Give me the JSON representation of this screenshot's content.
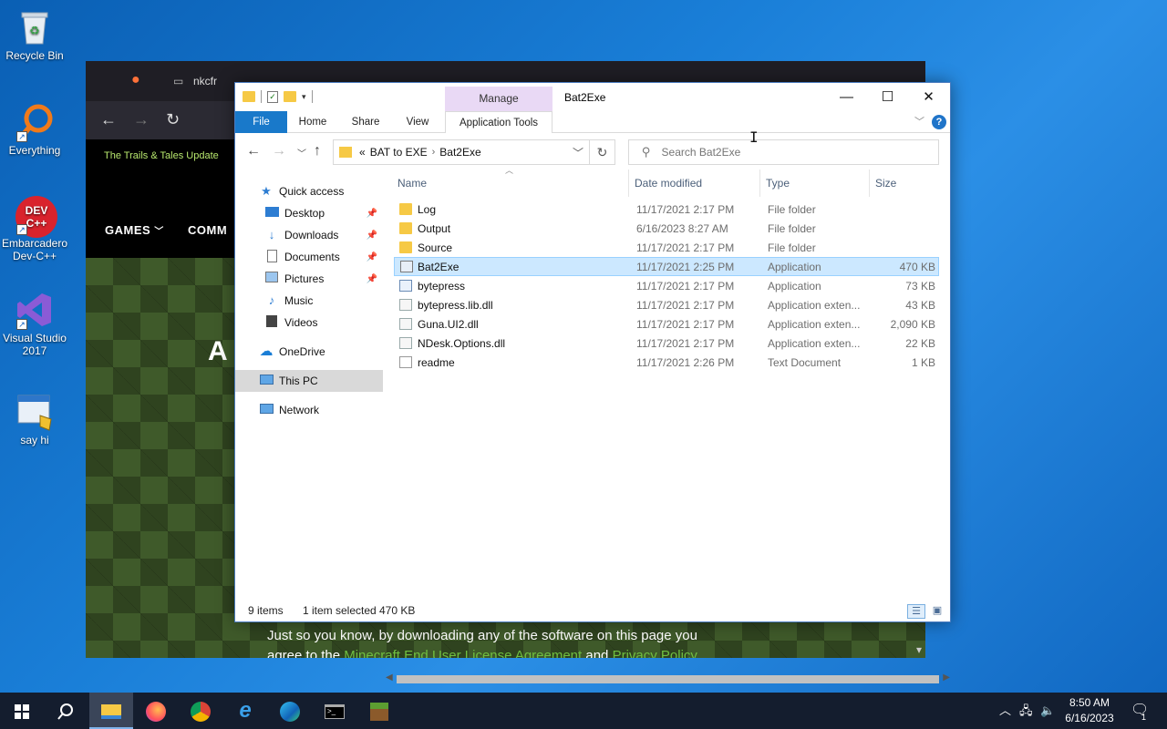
{
  "desktop": {
    "icons": [
      {
        "label": "Recycle Bin"
      },
      {
        "label": "Everything"
      },
      {
        "label": "Embarcadero Dev-C++"
      },
      {
        "label": "Visual Studio 2017"
      },
      {
        "label": "say hi"
      }
    ]
  },
  "browser": {
    "tab_label": "nkcfr",
    "promo_text": "The Trails & Tales Update",
    "menu_games": "GAMES",
    "menu_community": "COMM",
    "hero_letter": "A",
    "notice_line1": "Just so you know, by downloading any of the software on this page you",
    "notice_line2_pre": "agree to the ",
    "notice_link1": "Minecraft End User License Agreement",
    "notice_mid": " and ",
    "notice_link2": "Privacy Policy"
  },
  "explorer": {
    "title": "Bat2Exe",
    "manage_tab": "Manage",
    "ribbon_tabs": {
      "file": "File",
      "home": "Home",
      "share": "Share",
      "view": "View",
      "app_tools": "Application Tools"
    },
    "address": {
      "prefix": "«",
      "crumb1": "BAT to EXE",
      "crumb2": "Bat2Exe"
    },
    "search_placeholder": "Search Bat2Exe",
    "nav": {
      "quick_access": "Quick access",
      "desktop": "Desktop",
      "downloads": "Downloads",
      "documents": "Documents",
      "pictures": "Pictures",
      "music": "Music",
      "videos": "Videos",
      "onedrive": "OneDrive",
      "this_pc": "This PC",
      "network": "Network"
    },
    "columns": {
      "name": "Name",
      "date": "Date modified",
      "type": "Type",
      "size": "Size"
    },
    "files": [
      {
        "name": "Log",
        "date": "11/17/2021 2:17 PM",
        "type": "File folder",
        "size": ""
      },
      {
        "name": "Output",
        "date": "6/16/2023 8:27 AM",
        "type": "File folder",
        "size": ""
      },
      {
        "name": "Source",
        "date": "11/17/2021 2:17 PM",
        "type": "File folder",
        "size": ""
      },
      {
        "name": "Bat2Exe",
        "date": "11/17/2021 2:25 PM",
        "type": "Application",
        "size": "470 KB"
      },
      {
        "name": "bytepress",
        "date": "11/17/2021 2:17 PM",
        "type": "Application",
        "size": "73 KB"
      },
      {
        "name": "bytepress.lib.dll",
        "date": "11/17/2021 2:17 PM",
        "type": "Application exten...",
        "size": "43 KB"
      },
      {
        "name": "Guna.UI2.dll",
        "date": "11/17/2021 2:17 PM",
        "type": "Application exten...",
        "size": "2,090 KB"
      },
      {
        "name": "NDesk.Options.dll",
        "date": "11/17/2021 2:17 PM",
        "type": "Application exten...",
        "size": "22 KB"
      },
      {
        "name": "readme",
        "date": "11/17/2021 2:26 PM",
        "type": "Text Document",
        "size": "1 KB"
      }
    ],
    "status": {
      "items": "9 items",
      "selected": "1 item selected",
      "size": "470 KB"
    }
  },
  "taskbar": {
    "time": "8:50 AM",
    "date": "6/16/2023",
    "notification_count": "1"
  }
}
